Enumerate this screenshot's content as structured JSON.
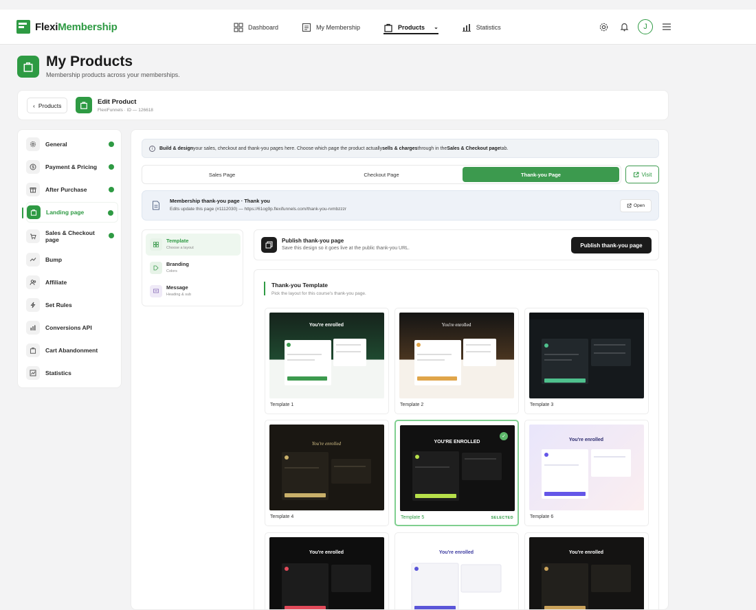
{
  "app": {
    "brand_part1": "Flexi",
    "brand_part2": "Membership"
  },
  "nav": {
    "items": [
      {
        "label": "Dashboard",
        "icon": "dashboard-icon"
      },
      {
        "label": "My Membership",
        "icon": "membership-icon"
      },
      {
        "label": "Products",
        "icon": "bag-icon"
      },
      {
        "label": "Statistics",
        "icon": "bar-chart-icon"
      }
    ]
  },
  "user": {
    "initial": "J"
  },
  "page": {
    "title": "My Products",
    "subtitle": "Membership products across your memberships."
  },
  "edit": {
    "back_label": "Products",
    "title": "Edit Product",
    "meta": "FlexiFunnels · ID — 126618"
  },
  "sidebar": {
    "items": [
      {
        "label": "General"
      },
      {
        "label": "Payment & Pricing"
      },
      {
        "label": "After Purchase"
      },
      {
        "label": "Landing page"
      },
      {
        "label": "Sales & Checkout page"
      },
      {
        "label": "Bump"
      },
      {
        "label": "Affiliate"
      },
      {
        "label": "Set Rules"
      },
      {
        "label": "Conversions API"
      },
      {
        "label": "Cart Abandonment"
      },
      {
        "label": "Statistics"
      }
    ]
  },
  "info": {
    "p1": "Build & design",
    "p2": " your sales, checkout and thank-you pages here. Choose which page the product actually ",
    "p3": "sells & charges",
    "p4": " through in the ",
    "p5": "Sales & Checkout page",
    "p6": " tab."
  },
  "tabs": [
    "Sales Page",
    "Checkout Page",
    "Thank-you Page"
  ],
  "visit_label": "Visit",
  "pagebar": {
    "title": "Membership thank-you page · Thank you",
    "sub": "Edits update this page (#1112030) — https://61og9p.flexifunnels.com/thank-you-rvmbzzzr",
    "open": "Open"
  },
  "subnav": [
    {
      "title": "Template",
      "sub": "Choose a layout"
    },
    {
      "title": "Branding",
      "sub": "Colors"
    },
    {
      "title": "Message",
      "sub": "Heading & sub"
    }
  ],
  "publish": {
    "title": "Publish thank-you page",
    "sub": "Save this design so it goes live at the public thank-you URL.",
    "button": "Publish thank-you page"
  },
  "templates": {
    "title": "Thank-you Template",
    "sub": "Pick the layout for this course's thank-you page.",
    "selected_label": "SELECTED",
    "items": [
      {
        "name": "Template 1"
      },
      {
        "name": "Template 2"
      },
      {
        "name": "Template 3"
      },
      {
        "name": "Template 4"
      },
      {
        "name": "Template 5"
      },
      {
        "name": "Template 6"
      },
      {
        "name": ""
      },
      {
        "name": ""
      },
      {
        "name": ""
      }
    ]
  },
  "colors": {
    "accent": "#2e9a43",
    "dark": "#1a1a1a"
  }
}
